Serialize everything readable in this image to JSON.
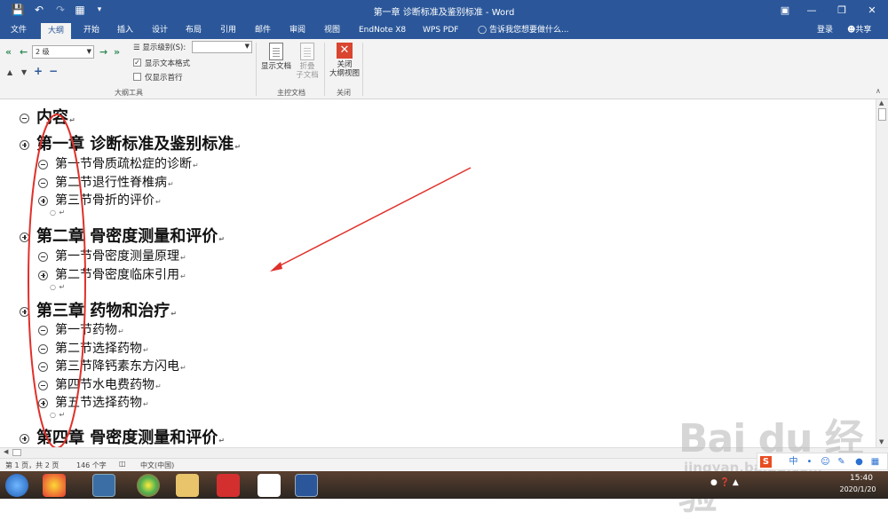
{
  "window": {
    "title": "第一章 诊断标准及鉴别标准 - Word"
  },
  "quick_access": [
    "save-icon",
    "undo-icon",
    "redo-icon",
    "customize-icon",
    "more-icon"
  ],
  "win_controls": [
    "restore-ribbon-icon",
    "minimize-icon",
    "maximize-icon",
    "close-icon"
  ],
  "tabs": [
    {
      "label": "文件"
    },
    {
      "label": "大纲"
    },
    {
      "label": "开始"
    },
    {
      "label": "插入"
    },
    {
      "label": "设计"
    },
    {
      "label": "布局"
    },
    {
      "label": "引用"
    },
    {
      "label": "邮件"
    },
    {
      "label": "审阅"
    },
    {
      "label": "视图"
    },
    {
      "label": "EndNote X8"
    },
    {
      "label": "WPS PDF"
    },
    {
      "label": "告诉我您想要做什么..."
    }
  ],
  "account": {
    "login": "登录",
    "share": "共享"
  },
  "ribbon": {
    "level_value": "2 级",
    "show_level_label": "显示级别(S):",
    "show_text_format": "显示文本格式",
    "show_first_line": "仅显示首行",
    "show_doc": "显示文档",
    "collapse_sub": [
      "折叠",
      "子文档"
    ],
    "close_outline": [
      "关闭",
      "大纲视图"
    ],
    "group_outline_tools": "大纲工具",
    "group_master_doc": "主控文档",
    "group_close": "关闭"
  },
  "outline": [
    {
      "level": 0,
      "symbol": "minus",
      "text": "内容"
    },
    {
      "level": 1,
      "symbol": "plus",
      "text": "第一章  诊断标准及鉴别标准"
    },
    {
      "level": 2,
      "symbol": "minus",
      "text": "第一节骨质疏松症的诊断"
    },
    {
      "level": 2,
      "symbol": "minus",
      "text": "第二节退行性脊椎病"
    },
    {
      "level": 2,
      "symbol": "plus",
      "text": "第三节骨折的评价"
    },
    {
      "level": 3,
      "symbol": "dot",
      "text": ""
    },
    {
      "level": 1,
      "symbol": "plus",
      "text": "第二章  骨密度测量和评价"
    },
    {
      "level": 2,
      "symbol": "minus",
      "text": "第一节骨密度测量原理"
    },
    {
      "level": 2,
      "symbol": "plus",
      "text": "第二节骨密度临床引用"
    },
    {
      "level": 3,
      "symbol": "dot",
      "text": ""
    },
    {
      "level": 1,
      "symbol": "plus",
      "text": "第三章  药物和治疗"
    },
    {
      "level": 2,
      "symbol": "minus",
      "text": "第一节药物"
    },
    {
      "level": 2,
      "symbol": "minus",
      "text": "第二节选择药物"
    },
    {
      "level": 2,
      "symbol": "minus",
      "text": "第三节降钙素东方闪电"
    },
    {
      "level": 2,
      "symbol": "minus",
      "text": "第四节水电费药物"
    },
    {
      "level": 2,
      "symbol": "plus",
      "text": "第五节选择药物"
    },
    {
      "level": 3,
      "symbol": "dot",
      "text": ""
    },
    {
      "level": 1,
      "symbol": "plus",
      "text": "第四章  骨密度测量和评价"
    }
  ],
  "status": {
    "page": "第 1 页，共 2 页",
    "words": "146 个字",
    "lang": "中文(中国)"
  },
  "tray": {
    "ime": "中",
    "time": "15:40",
    "date": "2020/1/20"
  },
  "watermark": {
    "brand": "Bai du 经验",
    "url": "jingyan.baidu.com"
  },
  "colors": {
    "word_blue": "#2b579a",
    "annotation_red": "#e0302a"
  }
}
